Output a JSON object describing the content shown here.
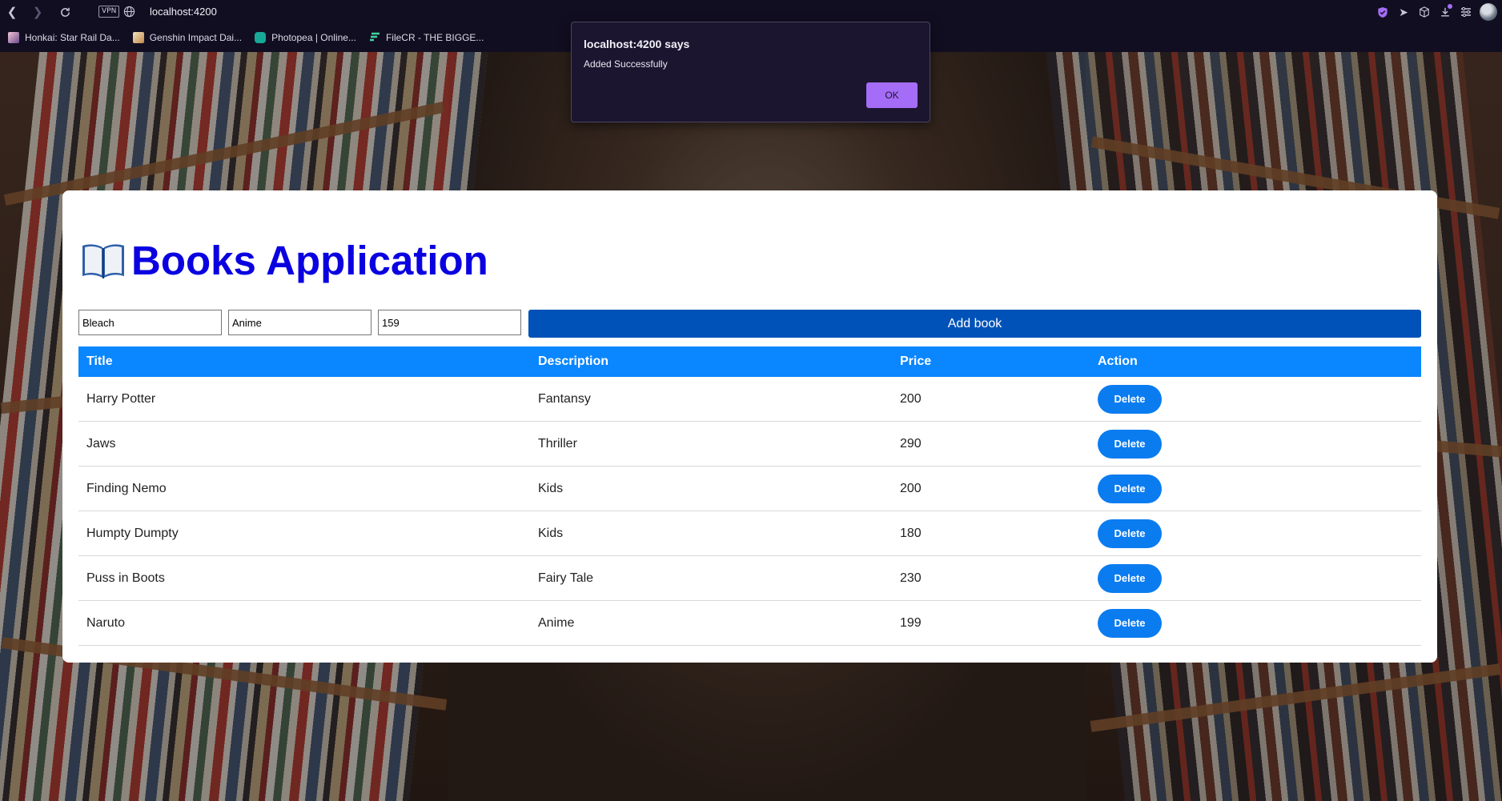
{
  "browser": {
    "url": "localhost:4200",
    "vpn_label": "VPN",
    "bookmarks": [
      {
        "label": "Honkai: Star Rail Da...",
        "icon": "honkai-favicon-icon"
      },
      {
        "label": "Genshin Impact Dai...",
        "icon": "genshin-favicon-icon"
      },
      {
        "label": "Photopea | Online...",
        "icon": "photopea-favicon-icon"
      },
      {
        "label": "FileCR - THE BIGGE...",
        "icon": "filecr-favicon-icon"
      }
    ]
  },
  "dialog": {
    "title": "localhost:4200 says",
    "message": "Added Successfully",
    "ok_label": "OK"
  },
  "app": {
    "title": "Books Application",
    "title_icon": "open-book-icon",
    "form": {
      "title_value": "Bleach",
      "description_value": "Anime",
      "price_value": "159",
      "add_label": "Add book"
    },
    "table": {
      "headers": [
        "Title",
        "Description",
        "Price",
        "Action"
      ],
      "rows": [
        {
          "title": "Harry Potter",
          "description": "Fantansy",
          "price": "200",
          "action": "Delete"
        },
        {
          "title": "Jaws",
          "description": "Thriller",
          "price": "290",
          "action": "Delete"
        },
        {
          "title": "Finding Nemo",
          "description": "Kids",
          "price": "200",
          "action": "Delete"
        },
        {
          "title": "Humpty Dumpty",
          "description": "Kids",
          "price": "180",
          "action": "Delete"
        },
        {
          "title": "Puss in Boots",
          "description": "Fairy Tale",
          "price": "230",
          "action": "Delete"
        },
        {
          "title": "Naruto",
          "description": "Anime",
          "price": "199",
          "action": "Delete"
        }
      ]
    }
  },
  "colors": {
    "title": "#0a00e0",
    "table_header": "#0a86ff",
    "add_button": "#0052b8",
    "delete_button": "#0a7cf0",
    "dialog_accent": "#a56cf7",
    "chrome_bg": "#120e22"
  }
}
